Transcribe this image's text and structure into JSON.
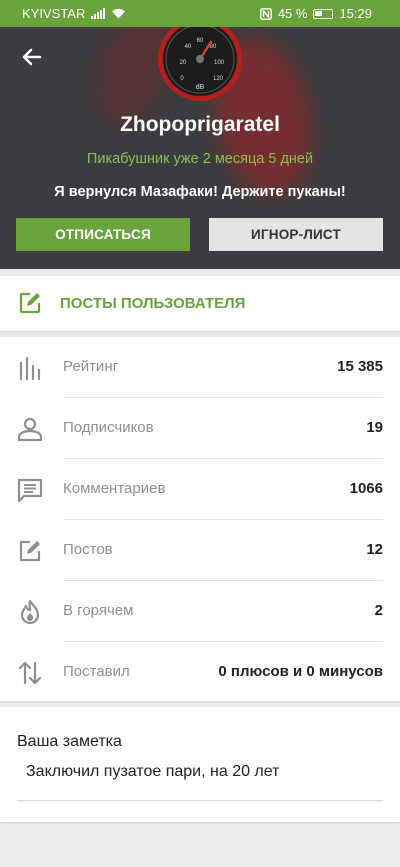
{
  "status_bar": {
    "carrier": "KYIVSTAR",
    "battery": "45 %",
    "time": "15:29"
  },
  "header": {
    "gauge_labels": [
      "20",
      "40",
      "60",
      "80",
      "100",
      "120",
      "0"
    ],
    "gauge_unit": "dB",
    "username": "Zhopoprigaratel",
    "since": "Пикабушник уже 2 месяца 5 дней",
    "motto": "Я вернулся Мазафаки! Держите пуканы!",
    "unsubscribe_label": "ОТПИСАТЬСЯ",
    "ignore_label": "ИГНОР-ЛИСТ"
  },
  "posts_link": {
    "label": "ПОСТЫ ПОЛЬЗОВАТЕЛЯ"
  },
  "stats": [
    {
      "icon": "bar-chart-icon",
      "label": "Рейтинг",
      "value": "15 385"
    },
    {
      "icon": "person-icon",
      "label": "Подписчиков",
      "value": "19"
    },
    {
      "icon": "comment-icon",
      "label": "Комментариев",
      "value": "1066"
    },
    {
      "icon": "edit-icon",
      "label": "Постов",
      "value": "12"
    },
    {
      "icon": "flame-icon",
      "label": "В горячем",
      "value": "2"
    },
    {
      "icon": "arrows-updown-icon",
      "label": "Поставил",
      "value": "0 плюсов и 0 минусов"
    }
  ],
  "note": {
    "title": "Ваша заметка",
    "text": "Заключил пузатое пари, на 20 лет"
  },
  "colors": {
    "accent": "#6aa33c",
    "header_bg": "#3a3c3f"
  }
}
